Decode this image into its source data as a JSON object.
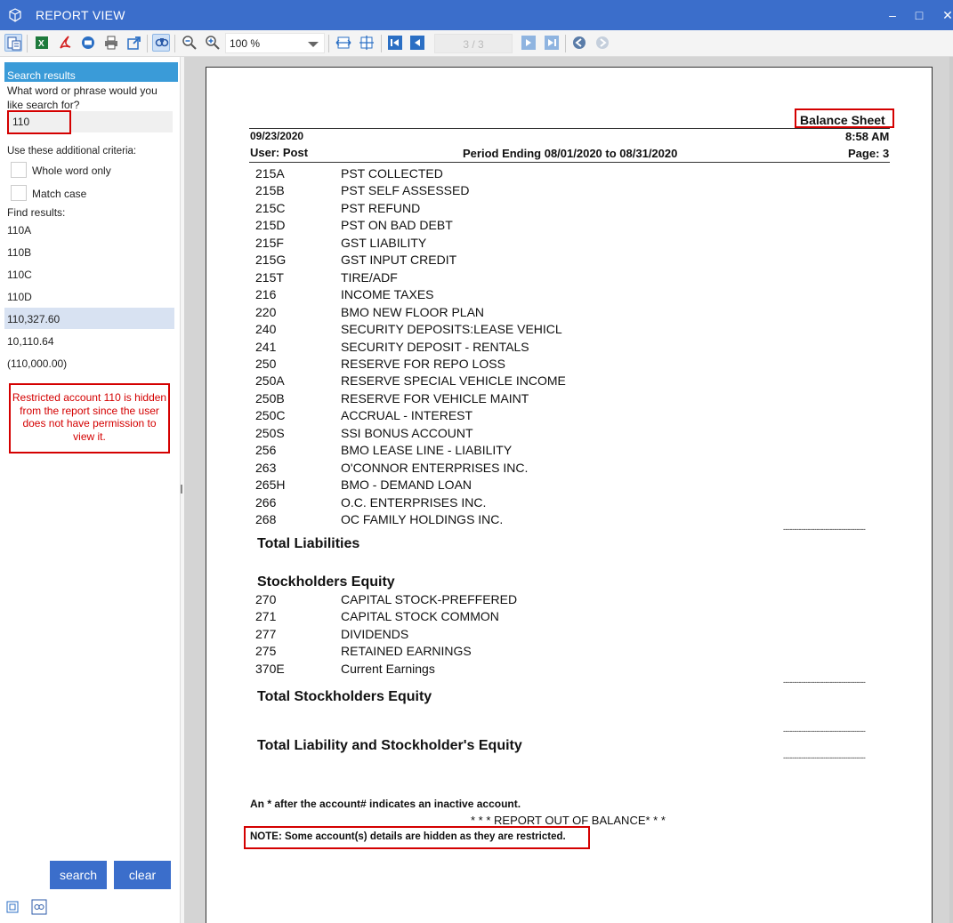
{
  "window": {
    "title": "REPORT VIEW"
  },
  "toolbar": {
    "zoom_value": "100 %",
    "page_indicator": "3 / 3"
  },
  "search_panel": {
    "header": "Search results",
    "prompt": "What word or phrase would you like search for?",
    "search_value": "110",
    "criteria_label": "Use these additional criteria:",
    "whole_word_label": "Whole word only",
    "match_case_label": "Match case",
    "find_results_label": "Find results:",
    "results": [
      "110A",
      "110B",
      "110C",
      "110D",
      "110,327.60",
      "10,110.64",
      "(110,000.00)"
    ],
    "restricted_message": "Restricted account 110 is hidden from the report since the user does not have permission to view it.",
    "search_button": "search",
    "clear_button": "clear"
  },
  "report": {
    "title": "Balance Sheet",
    "date": "09/23/2020",
    "time": "8:58 AM",
    "user": "User: Post",
    "period": "Period Ending 08/01/2020 to 08/31/2020",
    "page": "Page: 3",
    "liability_accounts": [
      {
        "code": "215A",
        "desc": "PST COLLECTED"
      },
      {
        "code": "215B",
        "desc": "PST SELF ASSESSED"
      },
      {
        "code": "215C",
        "desc": "PST REFUND"
      },
      {
        "code": "215D",
        "desc": "PST ON BAD DEBT"
      },
      {
        "code": "215F",
        "desc": "GST LIABILITY"
      },
      {
        "code": "215G",
        "desc": "GST INPUT CREDIT"
      },
      {
        "code": "215T",
        "desc": "TIRE/ADF"
      },
      {
        "code": "216",
        "desc": "INCOME TAXES"
      },
      {
        "code": "220",
        "desc": "BMO NEW FLOOR PLAN"
      },
      {
        "code": "240",
        "desc": "SECURITY DEPOSITS:LEASE VEHICL"
      },
      {
        "code": "241",
        "desc": "SECURITY DEPOSIT - RENTALS"
      },
      {
        "code": "250",
        "desc": "RESERVE FOR REPO LOSS"
      },
      {
        "code": "250A",
        "desc": "RESERVE SPECIAL VEHICLE INCOME"
      },
      {
        "code": "250B",
        "desc": "RESERVE FOR VEHICLE MAINT"
      },
      {
        "code": "250C",
        "desc": "ACCRUAL - INTEREST"
      },
      {
        "code": "250S",
        "desc": "SSI BONUS ACCOUNT"
      },
      {
        "code": "256",
        "desc": "BMO LEASE LINE - LIABILITY"
      },
      {
        "code": "263",
        "desc": "O'CONNOR ENTERPRISES INC."
      },
      {
        "code": "265H",
        "desc": "BMO - DEMAND LOAN"
      },
      {
        "code": "266",
        "desc": "O.C. ENTERPRISES INC."
      },
      {
        "code": "268",
        "desc": "OC FAMILY HOLDINGS INC."
      }
    ],
    "total_liabilities": "Total Liabilities",
    "equity_heading": "Stockholders Equity",
    "equity_accounts": [
      {
        "code": "270",
        "desc": "CAPITAL STOCK-PREFFERED"
      },
      {
        "code": "271",
        "desc": "CAPITAL STOCK COMMON"
      },
      {
        "code": "277",
        "desc": "DIVIDENDS"
      },
      {
        "code": "275",
        "desc": "RETAINED EARNINGS"
      },
      {
        "code": "370E",
        "desc": "Current Earnings"
      }
    ],
    "total_equity": "Total  Stockholders Equity",
    "total_liab_equity": "Total Liability and Stockholder's Equity",
    "dash_line": "-------------------------------------",
    "inactive_note": "An * after the account# indicates an inactive account.",
    "out_of_balance": "* * * REPORT OUT OF BALANCE* * *",
    "restricted_note": "NOTE: Some account(s) details are hidden as they are restricted."
  }
}
